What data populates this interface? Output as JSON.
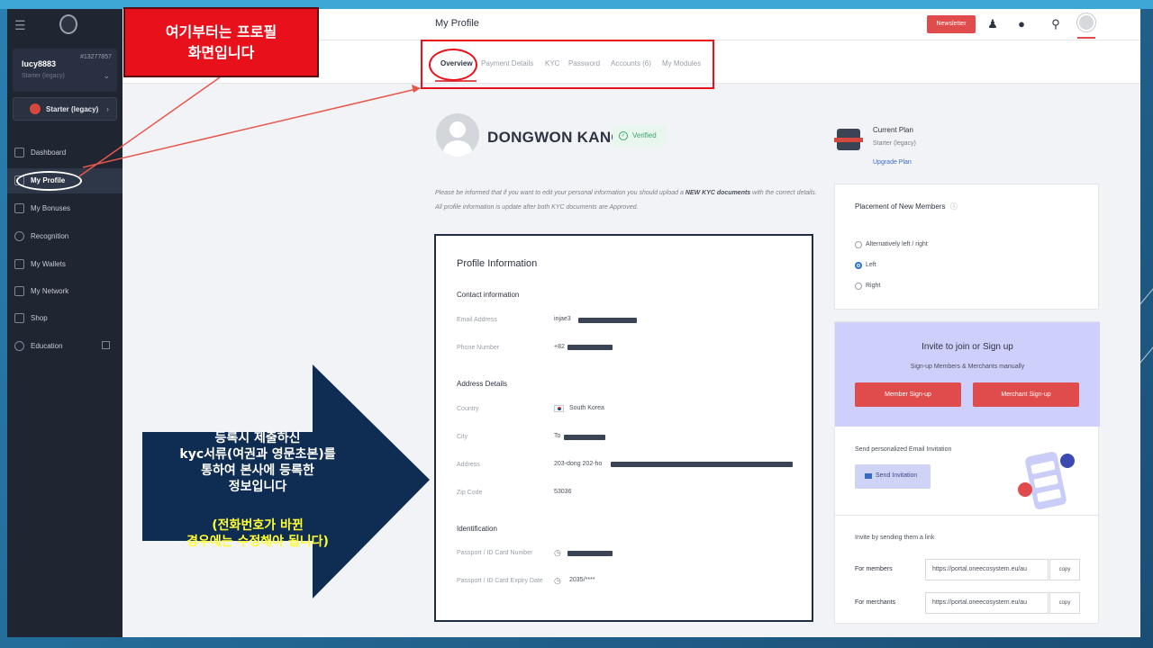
{
  "sidebar": {
    "username": "lucy8883",
    "user_id": "#13277857",
    "user_tier": "Starter (legacy)",
    "plan_label": "Starter (legacy)",
    "items": [
      {
        "label": "Dashboard"
      },
      {
        "label": "My Profile"
      },
      {
        "label": "My Bonuses"
      },
      {
        "label": "Recognition"
      },
      {
        "label": "My Wallets"
      },
      {
        "label": "My Network"
      },
      {
        "label": "Shop"
      },
      {
        "label": "Education"
      }
    ]
  },
  "header": {
    "title": "My Profile",
    "newsletter_label": "Newsletter"
  },
  "tabs": [
    {
      "label": "Overview"
    },
    {
      "label": "Payment Details"
    },
    {
      "label": "KYC"
    },
    {
      "label": "Password"
    },
    {
      "label": "Accounts (6)"
    },
    {
      "label": "My Modules"
    }
  ],
  "profile": {
    "name": "DONGWON KANG",
    "verified_label": "Verified",
    "note_prefix": "Please be informed that if you want to edit your personal information you should upload a",
    "note_bold": "NEW KYC documents",
    "note_suffix": "with the correct details. All profile information is update after both KYC documents are Approved."
  },
  "profile_info": {
    "title": "Profile Information",
    "contact_section": "Contact information",
    "email_label": "Email Address",
    "email_value": "injae3",
    "phone_label": "Phone Number",
    "phone_value": "+82",
    "address_section": "Address Details",
    "country_label": "Country",
    "country_value": "South Korea",
    "city_label": "City",
    "city_value": "To",
    "address_label": "Address",
    "address_value": "203-dong 202-ho",
    "zip_label": "Zip Code",
    "zip_value": "53036",
    "id_section": "Identification",
    "passport_label": "Passport / ID Card Number",
    "expiry_label": "Passport / ID Card Expiry Date",
    "expiry_value": "2035/****"
  },
  "plan": {
    "title": "Current Plan",
    "value": "Starter (legacy)",
    "link": "Upgrade Plan"
  },
  "placement": {
    "title": "Placement of New Members",
    "options": [
      {
        "label": "Alternatively left / right",
        "selected": false
      },
      {
        "label": "Left",
        "selected": true
      },
      {
        "label": "Right",
        "selected": false
      }
    ]
  },
  "invite": {
    "title": "Invite to join or Sign up",
    "subtitle": "Sign-up Members & Merchants manually",
    "member_btn": "Member Sign-up",
    "merchant_btn": "Merchant Sign-up",
    "email_title": "Send personalized Email Invitation",
    "send_btn": "Send Invitation",
    "link_title": "Invite by sending them a link",
    "members_label": "For members",
    "members_link": "https://portal.oneecosystem.eu/au",
    "merchants_label": "For merchants",
    "merchants_link": "https://portal.oneecosystem.eu/au",
    "copy_label": "copy"
  },
  "annotations": {
    "callout_line1": "여기부터는 프로필",
    "callout_line2": "화면입니다",
    "arrow_line1": "등록시 제출하신",
    "arrow_line2": "kyc서류(여권과 영문초본)를",
    "arrow_line3": "통하여 본사에 등록한",
    "arrow_line4": "정보입니다",
    "arrow_note1": "(전화번호가 바뀐",
    "arrow_note2": "경우에는 수정해야 됩니다)"
  },
  "colors": {
    "accent_red": "#e04b4b",
    "sidebar_bg": "#1f2632",
    "verified_green": "#3aa66b",
    "invite_bg": "#cfcffb",
    "annotation_red": "#e8101a",
    "arrow_navy": "#0f2d52"
  }
}
